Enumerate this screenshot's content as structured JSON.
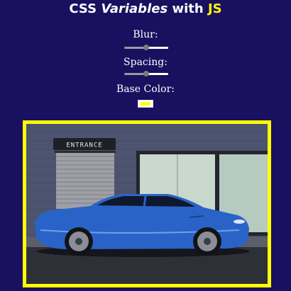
{
  "title": {
    "part1": "CSS ",
    "part2": "Variables",
    "part3": " with ",
    "part4": "JS"
  },
  "controls": {
    "blur": {
      "label": "Blur:",
      "value_fraction": 0.5
    },
    "spacing": {
      "label": "Spacing:",
      "value_fraction": 0.5
    },
    "base_color": {
      "label": "Base Color:",
      "value": "#ffff00"
    }
  },
  "photo": {
    "sign_text": "ENTRANCE"
  },
  "colors": {
    "background": "#1a1060",
    "accent": "#ffff00",
    "car": "#2a63c8"
  }
}
